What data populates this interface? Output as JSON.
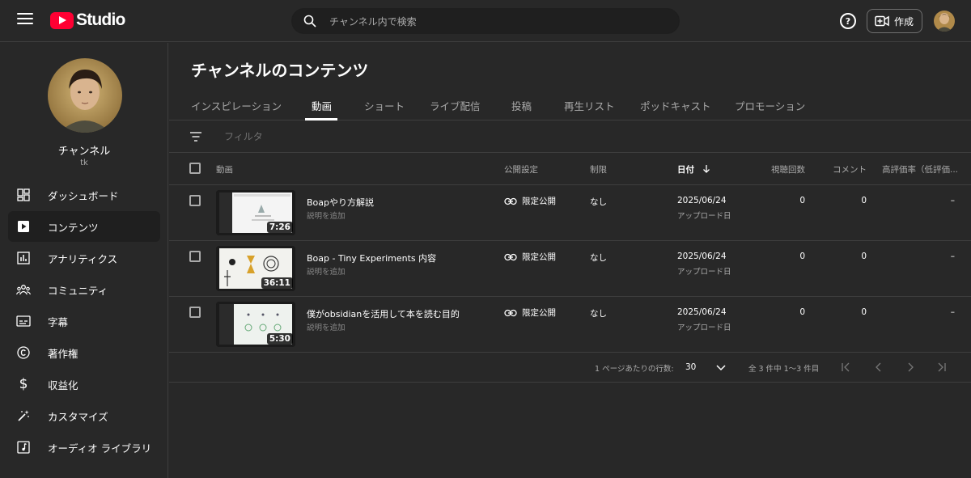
{
  "header": {
    "logo_text": "Studio",
    "search_placeholder": "チャンネル内で検索",
    "help_label": "?",
    "create_label": "作成"
  },
  "sidebar": {
    "channel_name": "チャンネル",
    "channel_handle": "tk",
    "items": [
      {
        "label": "ダッシュボード",
        "icon": "dashboard-icon"
      },
      {
        "label": "コンテンツ",
        "icon": "content-icon",
        "active": true
      },
      {
        "label": "アナリティクス",
        "icon": "analytics-icon"
      },
      {
        "label": "コミュニティ",
        "icon": "community-icon"
      },
      {
        "label": "字幕",
        "icon": "subtitles-icon"
      },
      {
        "label": "著作権",
        "icon": "copyright-icon"
      },
      {
        "label": "収益化",
        "icon": "dollar-icon"
      },
      {
        "label": "カスタマイズ",
        "icon": "magic-wand-icon"
      },
      {
        "label": "オーディオ ライブラリ",
        "icon": "audio-library-icon"
      }
    ]
  },
  "main": {
    "title": "チャンネルのコンテンツ",
    "tabs": [
      "インスピレーション",
      "動画",
      "ショート",
      "ライブ配信",
      "投稿",
      "再生リスト",
      "ポッドキャスト",
      "プロモーション"
    ],
    "active_tab": "動画",
    "filter_placeholder": "フィルタ",
    "columns": {
      "video": "動画",
      "visibility": "公開設定",
      "restrictions": "制限",
      "date": "日付",
      "views": "視聴回数",
      "comments": "コメント",
      "likes": "高評価率（低評価..."
    },
    "rows": [
      {
        "title": "Boapやり方解説",
        "description": "説明を追加",
        "duration": "7:26",
        "visibility": "限定公開",
        "restrictions": "なし",
        "date": "2025/06/24",
        "date_sub": "アップロード日",
        "views": "0",
        "comments": "0",
        "likes": "–"
      },
      {
        "title": "Boap - Tiny Experiments 内容",
        "description": "説明を追加",
        "duration": "36:11",
        "visibility": "限定公開",
        "restrictions": "なし",
        "date": "2025/06/24",
        "date_sub": "アップロード日",
        "views": "0",
        "comments": "0",
        "likes": "–"
      },
      {
        "title": "僕がobsidianを活用して本を読む目的",
        "description": "説明を追加",
        "duration": "5:30",
        "visibility": "限定公開",
        "restrictions": "なし",
        "date": "2025/06/24",
        "date_sub": "アップロード日",
        "views": "0",
        "comments": "0",
        "likes": "–"
      }
    ],
    "pagination": {
      "rows_per_page_label": "1 ページあたりの行数:",
      "rows_per_page": "30",
      "range_text": "全 3 件中 1〜3 件目"
    }
  },
  "colors": {
    "background": "#282828",
    "brand_red": "#ff0033",
    "divider": "#3e3e3e",
    "secondary_text": "#aaaaaa"
  }
}
